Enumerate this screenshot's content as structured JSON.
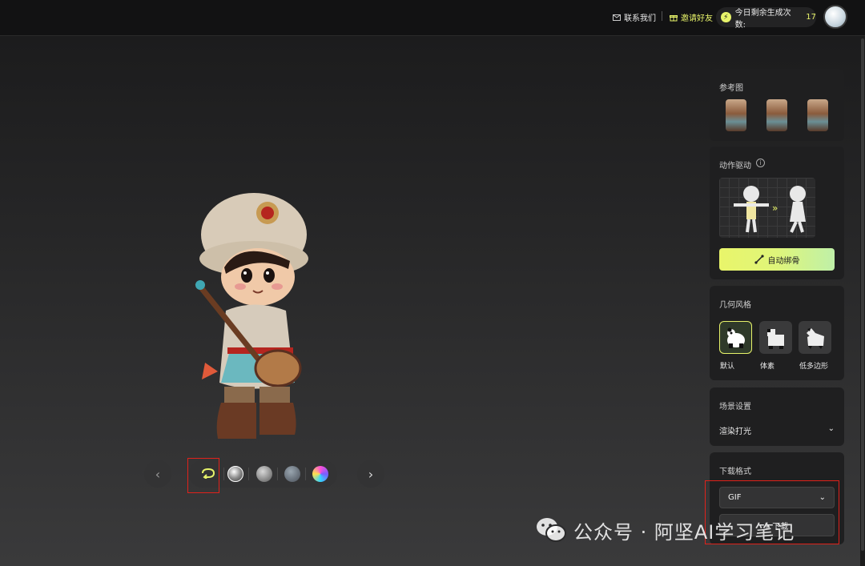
{
  "header": {
    "contact_label": "联系我们",
    "invite_label": "邀请好友",
    "credits_label": "今日剩余生成次数:",
    "credits_count": "17",
    "accent_color": "#e7f36a"
  },
  "toolbar": {
    "prev_icon": "‹",
    "next_icon": "›",
    "rotate_icon": "rotate-icon",
    "materials": [
      "material-clay",
      "material-gray",
      "material-texture",
      "material-rainbow"
    ]
  },
  "panel": {
    "reference": {
      "title": "参考图"
    },
    "motion": {
      "title": "动作驱动",
      "auto_rig_label": "自动绑骨"
    },
    "geometry": {
      "title": "几何风格",
      "options": [
        "默认",
        "体素",
        "低多边形"
      ],
      "selected": "默认"
    },
    "scene": {
      "title": "场景设置",
      "lighting_label": "渲染打光"
    },
    "download": {
      "title": "下载格式",
      "format_value": "GIF",
      "download_label": "下载"
    }
  },
  "watermark": {
    "text": "公众号 · 阿坚AI学习笔记"
  }
}
